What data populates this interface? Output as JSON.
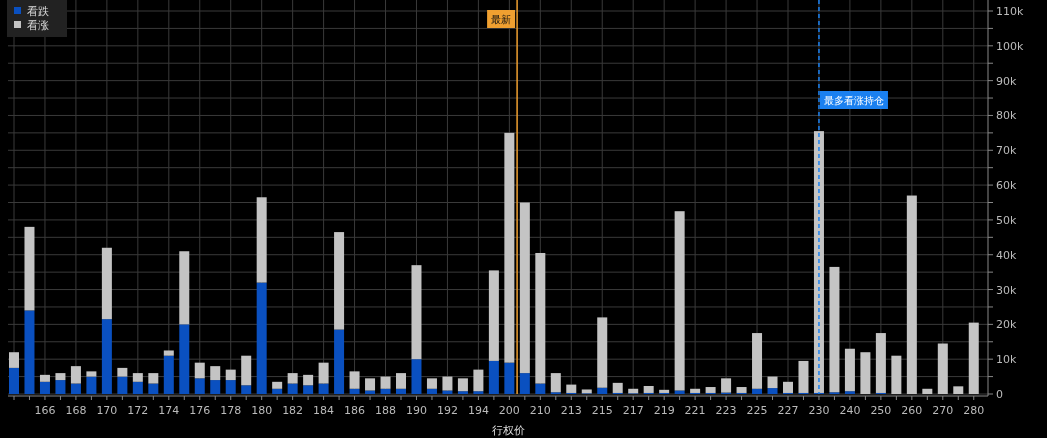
{
  "chart_data": {
    "type": "bar",
    "stacked": true,
    "xlabel": "行权价",
    "grid": true,
    "legend": true,
    "categories": [
      null,
      null,
      "166",
      null,
      "168",
      null,
      "170",
      null,
      "172",
      null,
      "174",
      null,
      "176",
      null,
      "178",
      null,
      "180",
      null,
      "182",
      null,
      "184",
      null,
      "186",
      null,
      "188",
      null,
      "190",
      null,
      "192",
      null,
      "194",
      null,
      "200",
      null,
      "210",
      null,
      "213",
      null,
      "215",
      null,
      "217",
      null,
      "219",
      null,
      "221",
      null,
      "223",
      null,
      "225",
      null,
      "227",
      null,
      "230",
      null,
      "240",
      null,
      "250",
      null,
      "260",
      null,
      "270",
      null,
      "280"
    ],
    "series": [
      {
        "name": "看跌",
        "color": "#0a50c0",
        "values": [
          7500,
          24000,
          3500,
          4000,
          3000,
          5000,
          21500,
          5000,
          3500,
          3000,
          11000,
          20000,
          4500,
          4000,
          4000,
          2500,
          32000,
          1500,
          3000,
          2500,
          3000,
          18500,
          1500,
          1000,
          1500,
          1500,
          10000,
          1500,
          1000,
          800,
          800,
          9500,
          9000,
          6000,
          3000,
          500,
          300,
          200,
          1800,
          300,
          200,
          300,
          300,
          1000,
          300,
          300,
          400,
          300,
          1500,
          1700,
          300,
          300,
          300,
          500,
          800,
          0,
          300,
          0,
          0,
          0,
          0,
          0,
          0
        ]
      },
      {
        "name": "看涨",
        "color": "#c4c4c4",
        "values": [
          4500,
          24000,
          2000,
          2000,
          5000,
          1500,
          20500,
          2500,
          2500,
          3000,
          1500,
          21000,
          4500,
          4000,
          3000,
          8500,
          24500,
          2000,
          3000,
          3000,
          6000,
          28000,
          5000,
          3500,
          3500,
          4500,
          27000,
          3000,
          4000,
          3700,
          6200,
          26000,
          66000,
          49000,
          37500,
          5500,
          2400,
          1100,
          20200,
          2900,
          1300,
          2000,
          900,
          51500,
          1200,
          1700,
          4100,
          1700,
          16000,
          3300,
          3200,
          9200,
          75200,
          36000,
          12200,
          12000,
          17200,
          11000,
          57000,
          1500,
          14500,
          2200,
          20500
        ]
      }
    ],
    "ylim": [
      0,
      110000
    ],
    "yticks": [
      {
        "value": 0,
        "label": "0"
      },
      {
        "value": 10000,
        "label": "10k"
      },
      {
        "value": 20000,
        "label": "20k"
      },
      {
        "value": 30000,
        "label": "30k"
      },
      {
        "value": 40000,
        "label": "40k"
      },
      {
        "value": 50000,
        "label": "50k"
      },
      {
        "value": 60000,
        "label": "60k"
      },
      {
        "value": 70000,
        "label": "70k"
      },
      {
        "value": 80000,
        "label": "80k"
      },
      {
        "value": 90000,
        "label": "90k"
      },
      {
        "value": 100000,
        "label": "100k"
      },
      {
        "value": 110000,
        "label": "110k"
      }
    ],
    "annotations": [
      "最新"
    ],
    "ref_lines": [
      {
        "axis": "x",
        "value": "230",
        "label": "最多看涨持仓",
        "color": "#1a80f0"
      }
    ]
  }
}
